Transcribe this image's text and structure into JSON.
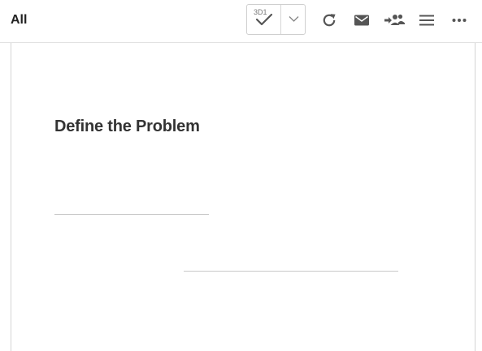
{
  "toolbar": {
    "title": "All",
    "approve_button": {
      "count": "3D1",
      "icon": "check-icon"
    },
    "dropdown_icon": "chevron-down-icon",
    "icons": [
      "refresh-icon",
      "mail-icon",
      "group-assign-icon",
      "menu-icon",
      "more-icon"
    ],
    "icon_color": "#555555"
  },
  "document": {
    "heading": "Define the Problem"
  },
  "colors": {
    "text": "#222222",
    "border": "#d4d4d4",
    "background": "#ffffff"
  }
}
